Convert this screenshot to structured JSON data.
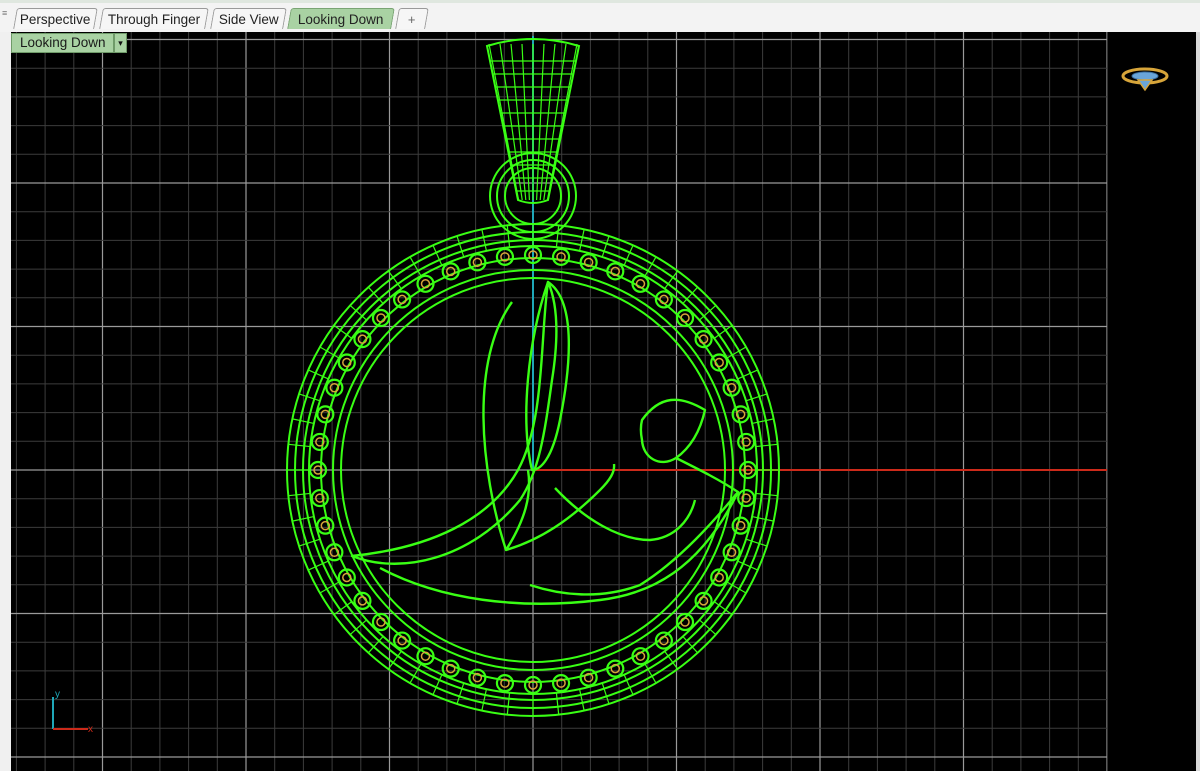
{
  "tabs": [
    {
      "label": "Perspective",
      "active": false
    },
    {
      "label": "Through Finger",
      "active": false
    },
    {
      "label": "Side View",
      "active": false
    },
    {
      "label": "Looking Down",
      "active": true
    }
  ],
  "add_tab_glyph": "+",
  "viewport": {
    "title": "Looking Down",
    "dropdown_glyph": "▾",
    "axis_x_label": "x",
    "axis_y_label": "y"
  },
  "colors": {
    "wire": "#39ff14",
    "x_axis": "#cc2a1a",
    "y_axis": "#1fa7b8",
    "grid_minor": "#3c3c3c",
    "grid_major": "#9a9a9a",
    "gem": "#d7a53a",
    "active_tab": "#a9d2a3"
  },
  "icons": [
    "navigation-gizmo-icon",
    "world-axes-icon",
    "dropdown-arrow-icon",
    "add-tab-icon"
  ]
}
